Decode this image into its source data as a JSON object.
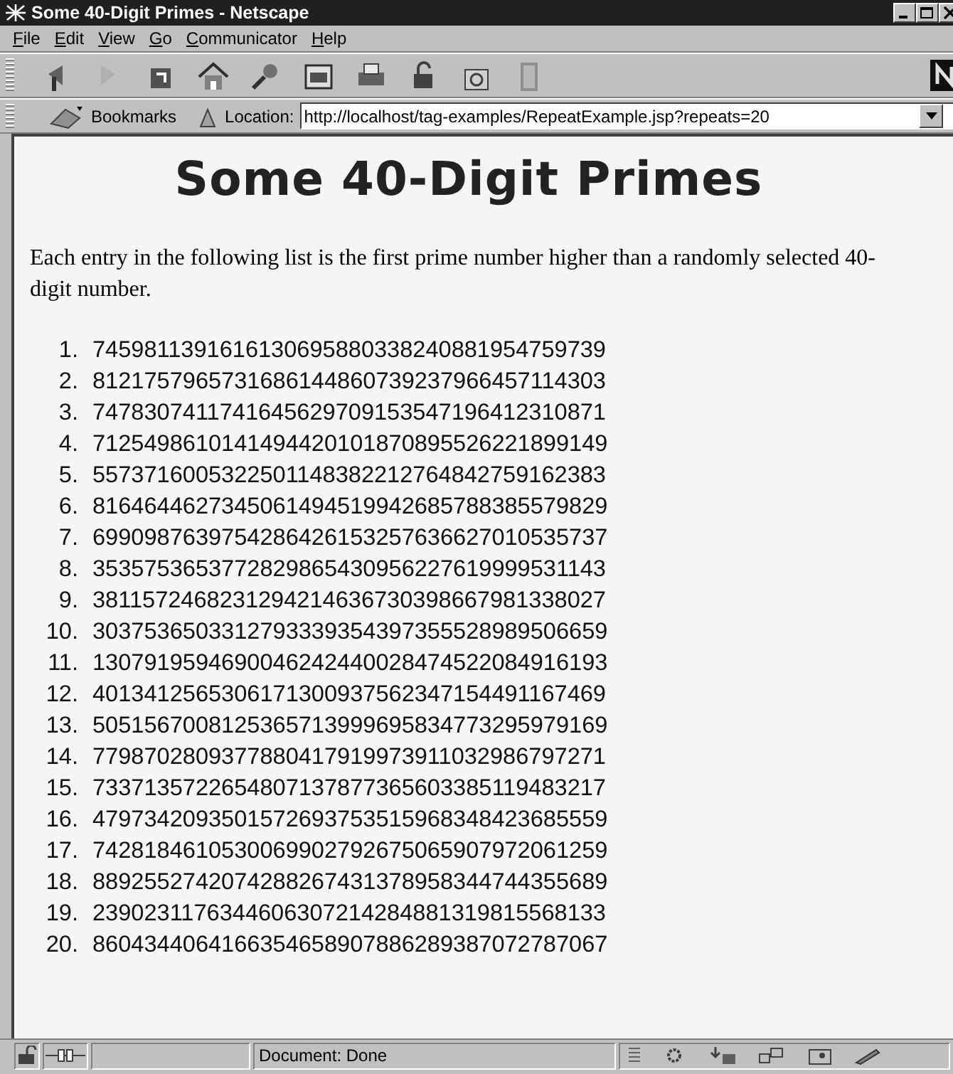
{
  "window": {
    "title": "Some 40-Digit Primes - Netscape"
  },
  "menu": [
    "File",
    "Edit",
    "View",
    "Go",
    "Communicator",
    "Help"
  ],
  "location_bar": {
    "bookmarks": "Bookmarks",
    "label": "Location:",
    "url": "http://localhost/tag-examples/RepeatExample.jsp?repeats=20"
  },
  "page": {
    "heading": "Some 40-Digit Primes",
    "intro": "Each entry in the following list is the first prime number higher than a randomly selected 40-digit number.",
    "primes": [
      {
        "number": "1.",
        "value": "7459811391616130695880338240881954759739"
      },
      {
        "number": "2.",
        "value": "8121757965731686144860739237966457114303"
      },
      {
        "number": "3.",
        "value": "7478307411741645629709153547196412310871"
      },
      {
        "number": "4.",
        "value": "7125498610141494420101870895526221899149"
      },
      {
        "number": "5.",
        "value": "5573716005322501148382212764842759162383"
      },
      {
        "number": "6.",
        "value": "8164644627345061494519942685788385579829"
      },
      {
        "number": "7.",
        "value": "6990987639754286426153257636627010535737"
      },
      {
        "number": "8.",
        "value": "3535753653772829865430956227619999531143"
      },
      {
        "number": "9.",
        "value": "3811572468231294214636730398667981338027"
      },
      {
        "number": "10.",
        "value": "3037536503312793339354397355528989506659"
      },
      {
        "number": "11.",
        "value": "1307919594690046242440028474522084916193"
      },
      {
        "number": "12.",
        "value": "4013412565306171300937562347154491167469"
      },
      {
        "number": "13.",
        "value": "5051567008125365713999695834773295979169"
      },
      {
        "number": "14.",
        "value": "7798702809377880417919973911032986797271"
      },
      {
        "number": "15.",
        "value": "7337135722654807137877365603385119483217"
      },
      {
        "number": "16.",
        "value": "4797342093501572693753515968348423685559"
      },
      {
        "number": "17.",
        "value": "7428184610530069902792675065907972061259"
      },
      {
        "number": "18.",
        "value": "8892552742074288267431378958344744355689"
      },
      {
        "number": "19.",
        "value": "2390231176344606307214284881319815568133"
      },
      {
        "number": "20.",
        "value": "8604344064166354658907886289387072787067"
      }
    ]
  },
  "status_bar": {
    "text": "Document: Done"
  }
}
